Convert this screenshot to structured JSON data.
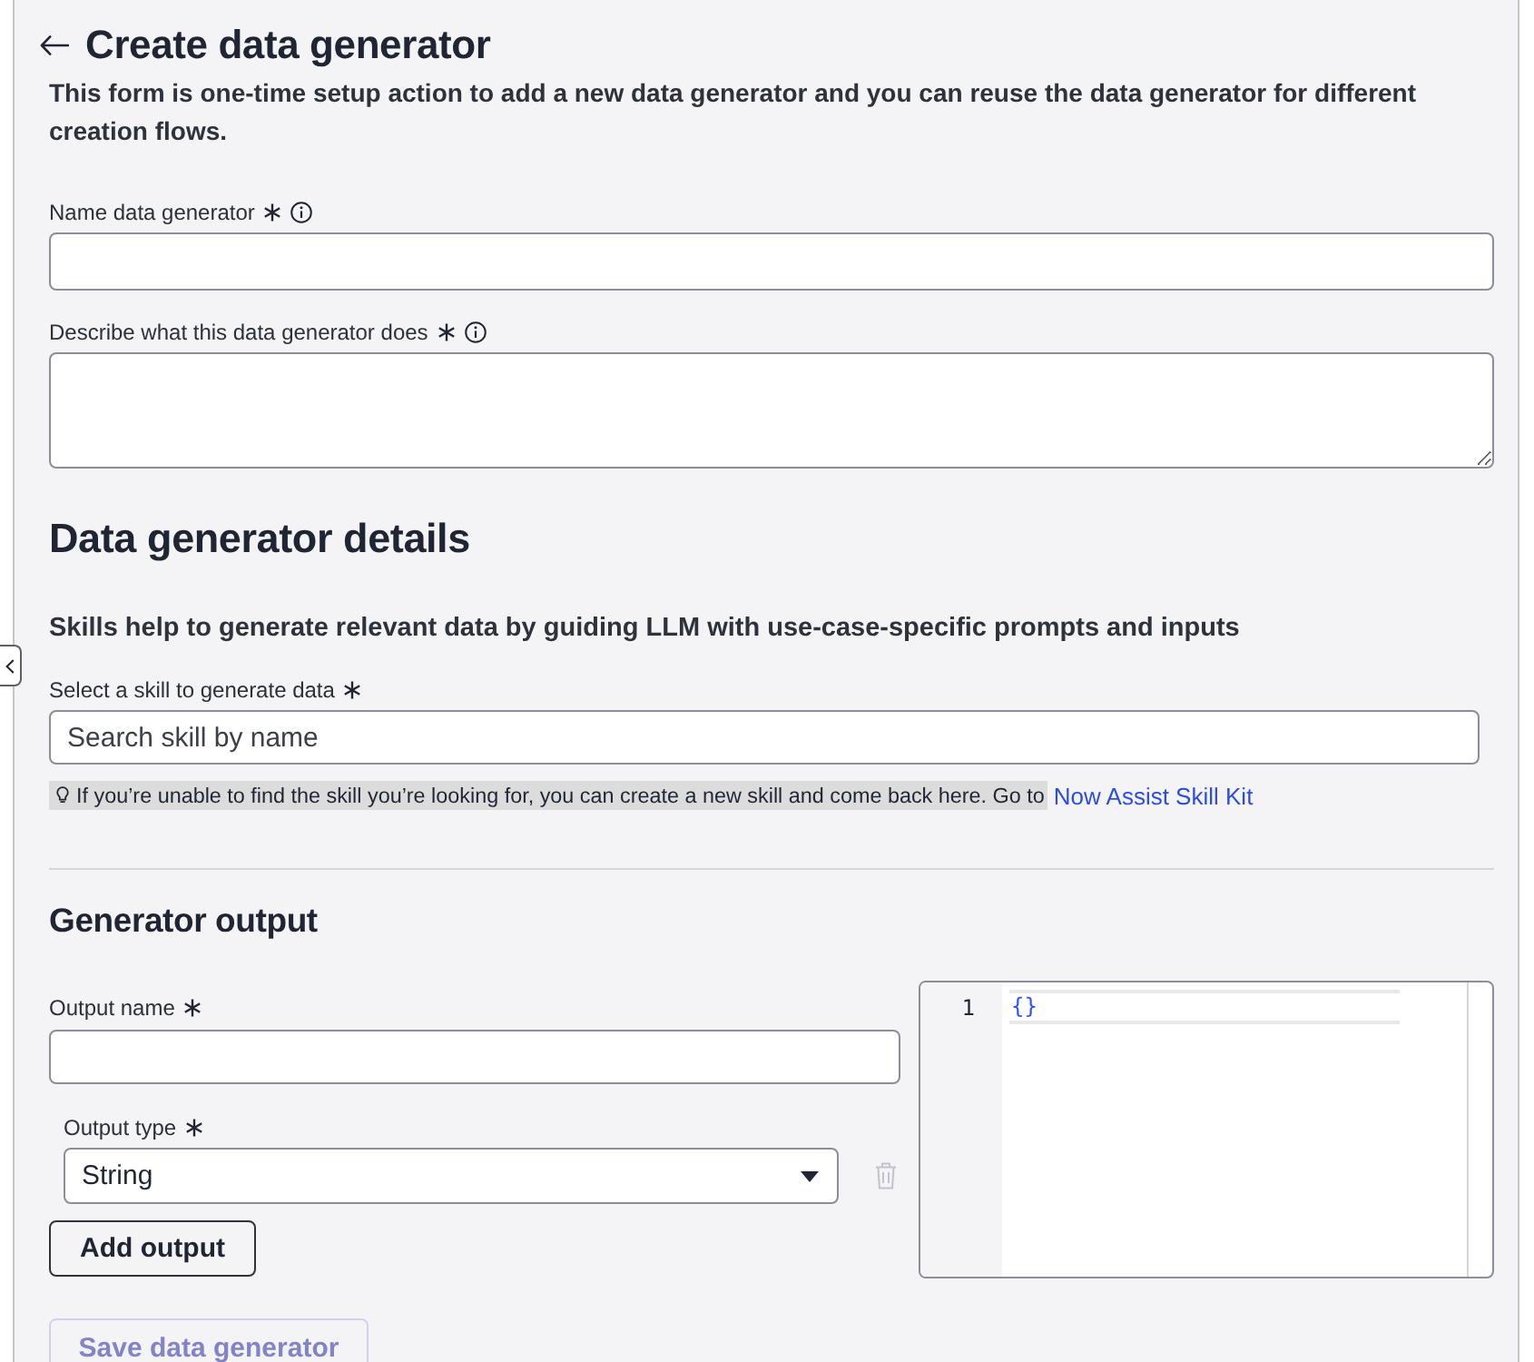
{
  "header": {
    "title": "Create data generator",
    "description": "This form is one-time setup action to add a new data generator and you can reuse the data generator for different creation flows."
  },
  "basic_fields": [
    {
      "kind": "input",
      "label": "Name data generator",
      "required": true,
      "info": true
    },
    {
      "kind": "textarea",
      "label": "Describe what this data generator does",
      "required": true,
      "info": true
    }
  ],
  "details": {
    "heading": "Data generator details",
    "intro": "Skills help to generate relevant data by guiding LLM with use-case-specific prompts and inputs",
    "skill_field": {
      "kind": "search",
      "label": "Select a skill to generate data",
      "required": true,
      "placeholder": "Search skill by name"
    },
    "hint": {
      "text": "If you’re unable to find the skill you’re looking for, you can create a new skill and come back here. Go to",
      "link": "Now Assist Skill Kit"
    }
  },
  "output": {
    "heading": "Generator output",
    "name_field": {
      "kind": "input",
      "label": "Output name",
      "required": true
    },
    "type_field": {
      "kind": "select",
      "label": "Output type",
      "required": true,
      "value": "String"
    },
    "delete_disabled": true,
    "add_button": "Add output",
    "editor": {
      "lines": [
        {
          "number": "1",
          "code": "{}"
        }
      ]
    }
  },
  "save_button": {
    "label": "Save data generator",
    "disabled": true
  }
}
